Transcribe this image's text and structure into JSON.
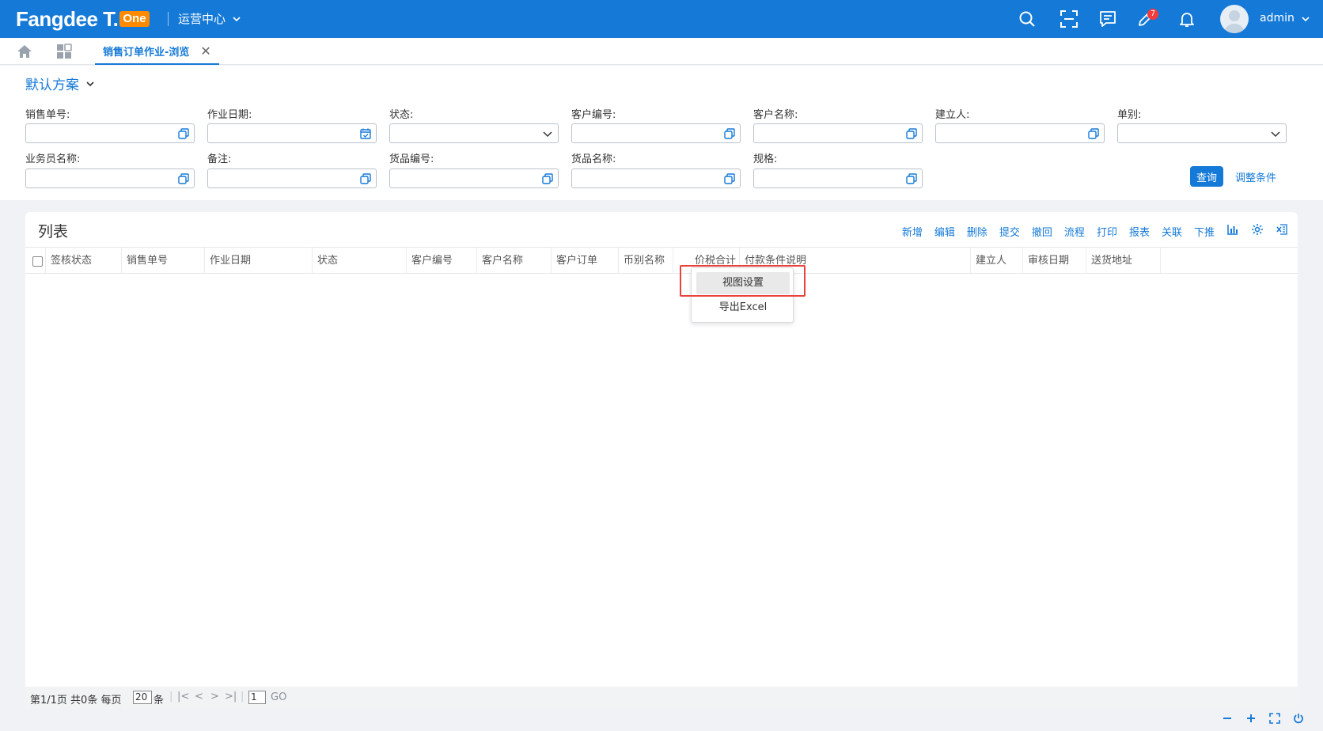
{
  "header": {
    "logo_text": "Fangdee T.",
    "logo_badge": "One",
    "center_menu": "运营中心",
    "badge_count": "7",
    "user_name": "admin"
  },
  "tabs": {
    "active_label": "销售订单作业-浏览"
  },
  "filter": {
    "scheme": "默认方案",
    "fields": [
      {
        "label": "销售单号:"
      },
      {
        "label": "作业日期:"
      },
      {
        "label": "状态:"
      },
      {
        "label": "客户编号:"
      },
      {
        "label": "客户名称:"
      },
      {
        "label": "建立人:"
      },
      {
        "label": "单别:"
      },
      {
        "label": "业务员名称:"
      },
      {
        "label": "备注:"
      },
      {
        "label": "货品编号:"
      },
      {
        "label": "货品名称:"
      },
      {
        "label": "规格:"
      }
    ],
    "query_label": "查询",
    "adjust_label": "调整条件"
  },
  "list": {
    "title": "列表",
    "toolbar": [
      "新增",
      "编辑",
      "删除",
      "提交",
      "撤回",
      "流程",
      "打印",
      "报表",
      "关联",
      "下推"
    ],
    "columns": [
      "签核状态",
      "销售单号",
      "作业日期",
      "状态",
      "客户编号",
      "客户名称",
      "客户订单",
      "币别名称",
      "价税合计",
      "付款条件说明",
      "建立人",
      "审核日期",
      "送货地址"
    ]
  },
  "context_menu": {
    "items": [
      "视图设置",
      "导出Excel"
    ]
  },
  "pager": {
    "page_info": "第1/1页 共0条 每页",
    "page_size": "20",
    "unit": "条",
    "page_input": "1",
    "go_label": "GO"
  },
  "colors": {
    "primary": "#1479d7",
    "badge": "#f23c3c",
    "logo_badge": "#ff8a00",
    "highlight_border": "#e8423c"
  }
}
